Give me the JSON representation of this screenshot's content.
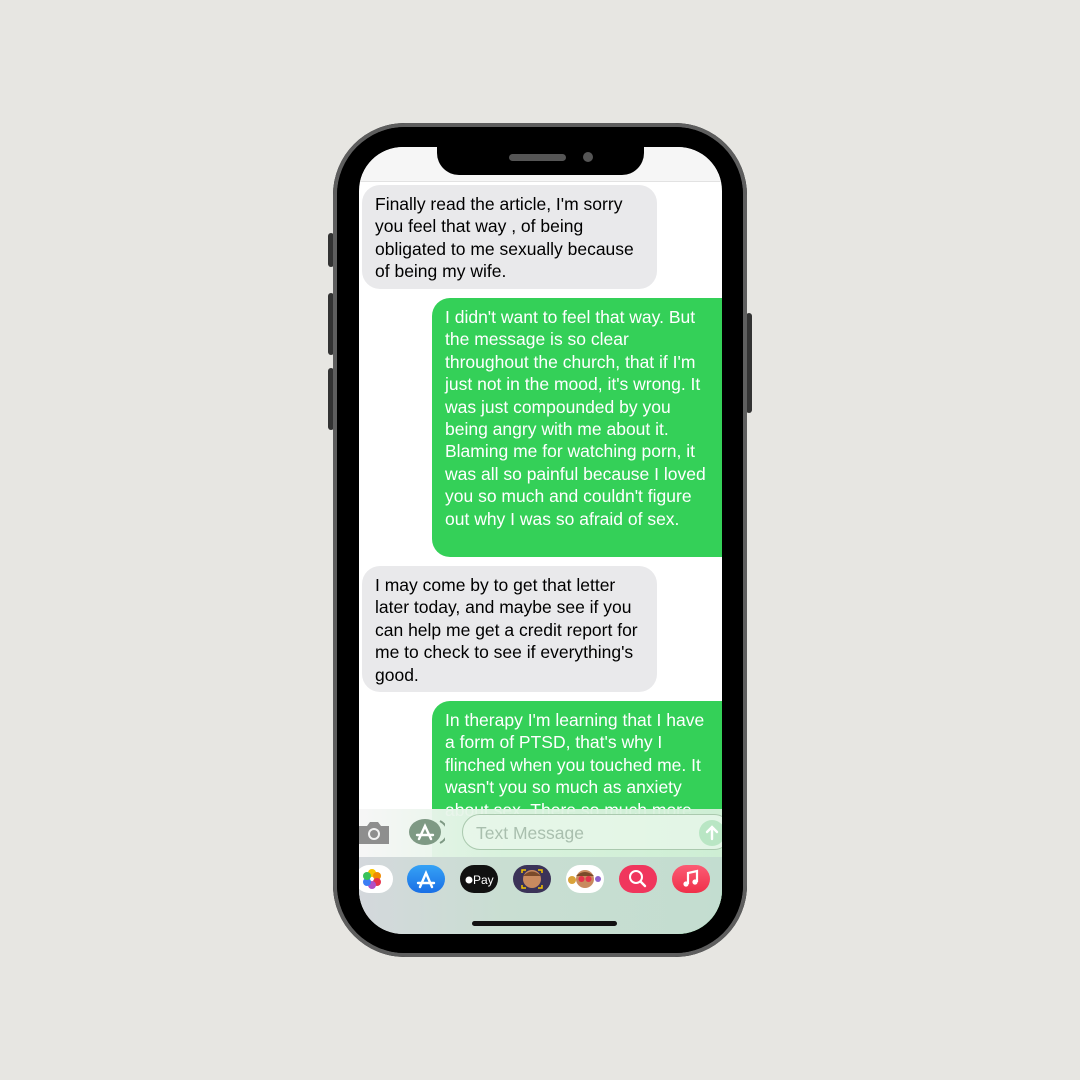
{
  "device": "iPhone",
  "conversation": {
    "messages": [
      {
        "direction": "received",
        "text": "Finally read  the article,  I'm sorry you feel that way , of being obligated to me sexually because of being my wife."
      },
      {
        "direction": "sent",
        "text": "I didn't want to feel that way. But the message is so clear throughout the church, that if I'm just not in the mood, it's wrong. It was just compounded by you being angry with me about it. Blaming me for watching porn, it was all so painful because I loved you so much and couldn't figure out why I was so afraid of sex."
      },
      {
        "direction": "received",
        "text": "I may come by to get  that letter later today, and maybe see if you can help me get a credit report for me to check to see if everything's good."
      },
      {
        "direction": "sent",
        "text": "In therapy I'm learning that I have a form of PTSD, that's why I flinched when you touched me. It wasn't you so much as anxiety about sex. There so much more"
      }
    ]
  },
  "compose": {
    "placeholder": "Text Message",
    "camera_icon": "camera-icon",
    "apps_icon": "app-store-icon",
    "send_icon": "send-arrow-icon"
  },
  "app_drawer": {
    "apps": [
      {
        "name": "Photos",
        "icon": "photos-icon"
      },
      {
        "name": "App Store",
        "icon": "app-store-icon"
      },
      {
        "name": "Apple Pay",
        "label": "Pay",
        "icon": "apple-pay-icon"
      },
      {
        "name": "Memoji",
        "icon": "memoji-icon"
      },
      {
        "name": "Memoji Stickers",
        "icon": "memoji-stickers-icon"
      },
      {
        "name": "Search Images",
        "icon": "image-search-icon"
      },
      {
        "name": "Music",
        "icon": "music-icon"
      }
    ]
  },
  "colors": {
    "sent_bubble": "#34d058",
    "received_bubble": "#e9e9eb",
    "background": "#e7e6e2"
  }
}
